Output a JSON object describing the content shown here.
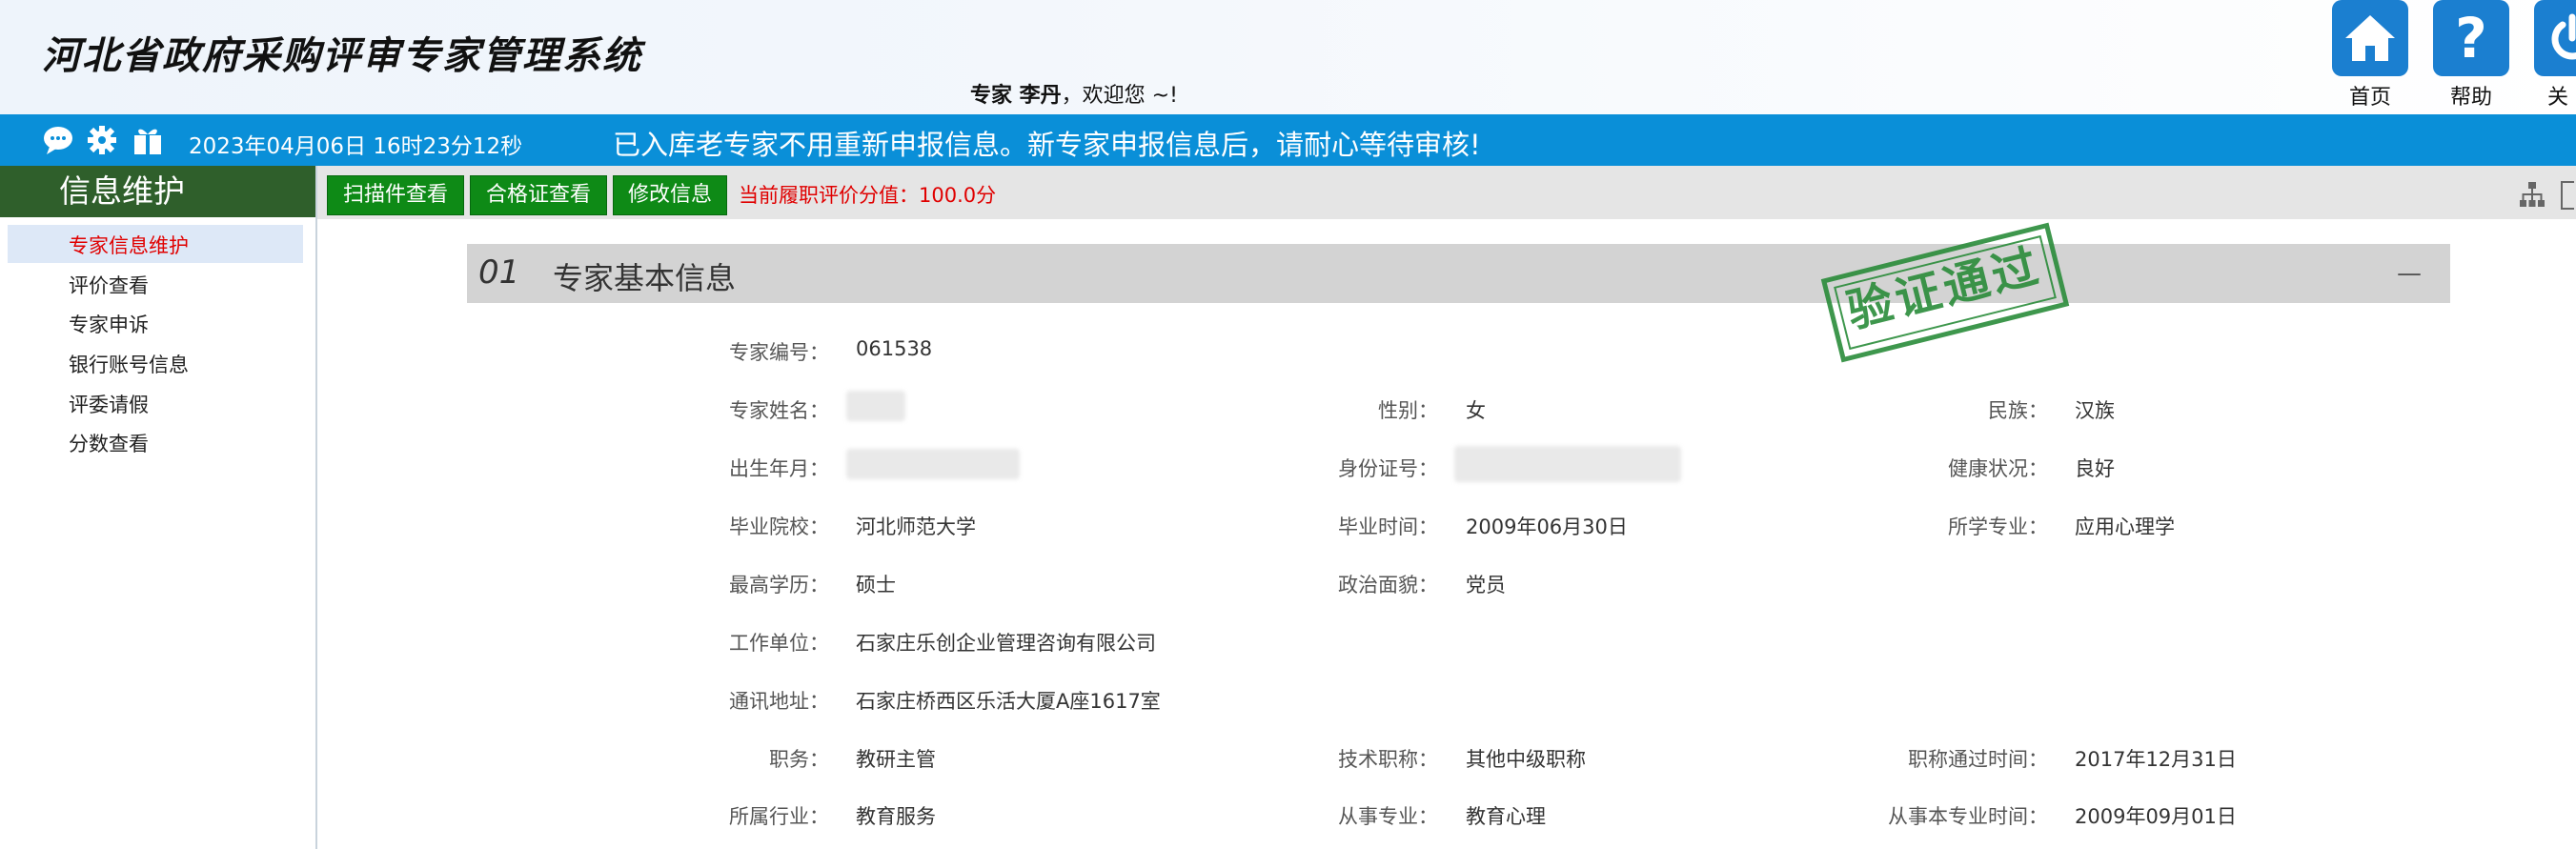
{
  "header": {
    "title": "河北省政府采购评审专家管理系统",
    "welcome_prefix": "专家 李丹",
    "welcome_suffix": "，欢迎您 ~!",
    "buttons": [
      {
        "label": "首页",
        "icon": "home-icon"
      },
      {
        "label": "帮助",
        "icon": "help-icon"
      },
      {
        "label": "关闭",
        "icon": "power-icon"
      }
    ]
  },
  "bar": {
    "datetime": "2023年04月06日 16时23分12秒",
    "notice": "已入库老专家不用重新申报信息。新专家申报信息后，请耐心等待审核!",
    "icons": [
      "chat-icon",
      "gear-icon",
      "gift-icon"
    ]
  },
  "sidebar": {
    "title": "信息维护",
    "items": [
      {
        "label": "专家信息维护",
        "active": true
      },
      {
        "label": "评价查看"
      },
      {
        "label": "专家申诉"
      },
      {
        "label": "银行账号信息"
      },
      {
        "label": "评委请假"
      },
      {
        "label": "分数查看"
      }
    ]
  },
  "toolbar": {
    "buttons": [
      "扫描件查看",
      "合格证查看",
      "修改信息"
    ],
    "score": "当前履职评价分值：100.0分"
  },
  "section": {
    "number": "01",
    "title": "专家基本信息",
    "collapse": "—",
    "stamp": "验证通过"
  },
  "fields": {
    "expert_no_label": "专家编号：",
    "expert_no": "061538",
    "name_label": "专家姓名：",
    "gender_label": "性别：",
    "gender": "女",
    "nation_label": "民族：",
    "nation": "汉族",
    "birth_label": "出生年月：",
    "id_label": "身份证号：",
    "health_label": "健康状况：",
    "health": "良好",
    "school_label": "毕业院校：",
    "school": "河北师范大学",
    "grad_time_label": "毕业时间：",
    "grad_time": "2009年06月30日",
    "major_label": "所学专业：",
    "major": "应用心理学",
    "degree_label": "最高学历：",
    "degree": "硕士",
    "politics_label": "政治面貌：",
    "politics": "党员",
    "employer_label": "工作单位：",
    "employer": "石家庄乐创企业管理咨询有限公司",
    "address_label": "通讯地址：",
    "address": "石家庄桥西区乐活大厦A座1617室",
    "duty_label": "职务：",
    "duty": "教研主管",
    "title_label": "技术职称：",
    "title": "其他中级职称",
    "title_time_label": "职称通过时间：",
    "title_time": "2017年12月31日",
    "industry_label": "所属行业：",
    "industry": "教育服务",
    "specialty_label": "从事专业：",
    "specialty": "教育心理",
    "specialty_time_label": "从事本专业时间：",
    "specialty_time": "2009年09月01日"
  },
  "colors": {
    "brand_blue": "#0a8fd8",
    "sidebar_green": "#2f5f2b",
    "button_green": "#0e8a16",
    "score_red": "#e00000",
    "stamp_green": "#2a8c3a"
  }
}
